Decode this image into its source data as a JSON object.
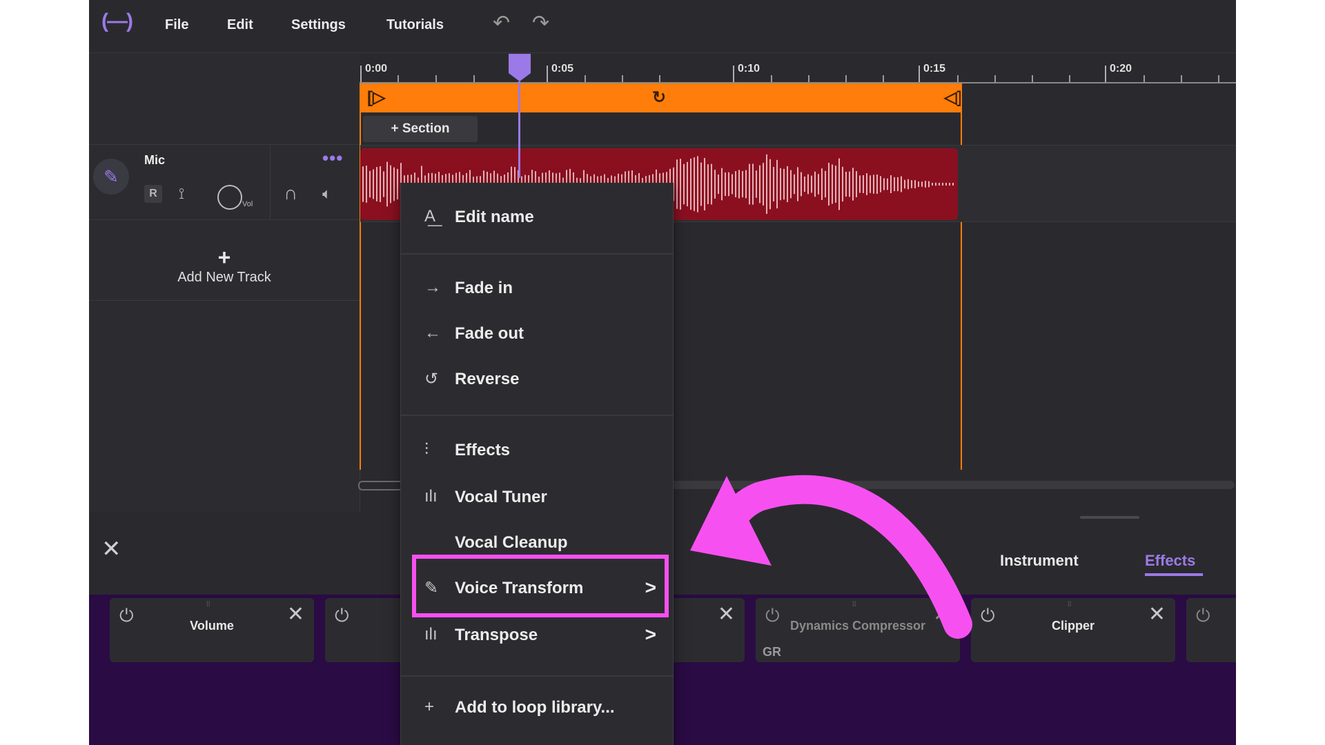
{
  "app": {
    "logo": "(—)",
    "menu": [
      "File",
      "Edit",
      "Settings",
      "Tutorials"
    ],
    "undo_icon": "undo-icon",
    "redo_icon": "redo-icon"
  },
  "timeline": {
    "tick_labels": [
      "0:00",
      "0:05",
      "0:10",
      "0:15",
      "0:20"
    ],
    "add_section_label": "+ Section"
  },
  "track": {
    "name": "Mic",
    "more_label": "•••",
    "record_label": "R",
    "volume_label": "Vol"
  },
  "add_track": {
    "plus": "+",
    "label": "Add New Track"
  },
  "context_menu": {
    "items": [
      {
        "label": "Edit name",
        "icon": "rename-icon"
      },
      {
        "label": "Fade in",
        "icon": "arrow-right-icon"
      },
      {
        "label": "Fade out",
        "icon": "arrow-left-icon"
      },
      {
        "label": "Reverse",
        "icon": "reverse-icon"
      },
      {
        "label": "Effects",
        "icon": "sliders-icon"
      },
      {
        "label": "Vocal Tuner",
        "icon": "waveform-icon"
      },
      {
        "label": "Vocal Cleanup",
        "icon": ""
      },
      {
        "label": "Voice Transform",
        "icon": "microphone-icon",
        "submenu": true
      },
      {
        "label": "Transpose",
        "icon": "waveform-icon",
        "submenu": true
      },
      {
        "label": "Add to loop library...",
        "icon": "plus-icon"
      }
    ],
    "highlighted": "Voice Transform",
    "highlight_color": "#f750f0"
  },
  "bottom_panel": {
    "tabs": [
      "Instrument",
      "Effects"
    ],
    "active_tab": "Effects",
    "effects": [
      {
        "name": "Volume"
      },
      {
        "name": ""
      },
      {
        "name": ""
      },
      {
        "name": "Dynamics Compressor",
        "meter_label": "GR"
      },
      {
        "name": "Clipper"
      },
      {
        "name": ""
      }
    ]
  },
  "colors": {
    "accent": "#9b7ae8",
    "loop": "#ff7d0a",
    "clip": "#8a1020",
    "effects_bg": "#2a0b44",
    "annotation": "#f750f0"
  }
}
